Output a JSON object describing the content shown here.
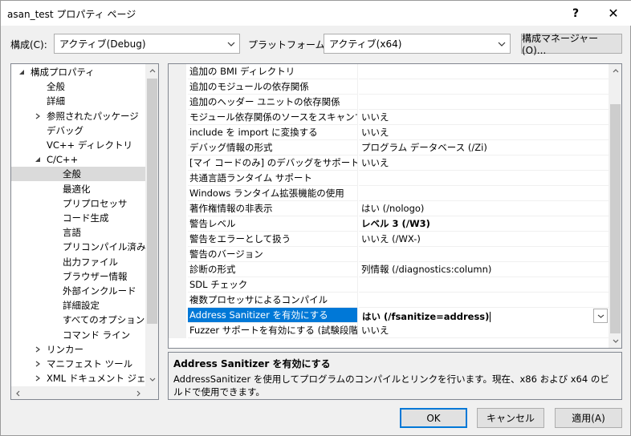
{
  "window": {
    "title": "asan_test プロパティ ページ",
    "help_glyph": "?",
    "close_glyph": "✕"
  },
  "config": {
    "config_label": "構成(C):",
    "config_value": "アクティブ(Debug)",
    "platform_label": "プラットフォーム(P):",
    "platform_value": "アクティブ(x64)",
    "manager_button": "構成マネージャー(O)..."
  },
  "tree": {
    "items": [
      {
        "label": "構成プロパティ",
        "level": 0,
        "expander": "expanded"
      },
      {
        "label": "全般",
        "level": 1,
        "expander": "none"
      },
      {
        "label": "詳細",
        "level": 1,
        "expander": "none"
      },
      {
        "label": "参照されたパッケージ",
        "level": 1,
        "expander": "collapsed"
      },
      {
        "label": "デバッグ",
        "level": 1,
        "expander": "none"
      },
      {
        "label": "VC++ ディレクトリ",
        "level": 1,
        "expander": "none"
      },
      {
        "label": "C/C++",
        "level": 1,
        "expander": "expanded"
      },
      {
        "label": "全般",
        "level": 2,
        "expander": "none",
        "selected": true
      },
      {
        "label": "最適化",
        "level": 2,
        "expander": "none"
      },
      {
        "label": "プリプロセッサ",
        "level": 2,
        "expander": "none"
      },
      {
        "label": "コード生成",
        "level": 2,
        "expander": "none"
      },
      {
        "label": "言語",
        "level": 2,
        "expander": "none"
      },
      {
        "label": "プリコンパイル済みヘッダー",
        "level": 2,
        "expander": "none"
      },
      {
        "label": "出力ファイル",
        "level": 2,
        "expander": "none"
      },
      {
        "label": "ブラウザー情報",
        "level": 2,
        "expander": "none"
      },
      {
        "label": "外部インクルード",
        "level": 2,
        "expander": "none"
      },
      {
        "label": "詳細設定",
        "level": 2,
        "expander": "none"
      },
      {
        "label": "すべてのオプション",
        "level": 2,
        "expander": "none"
      },
      {
        "label": "コマンド ライン",
        "level": 2,
        "expander": "none"
      },
      {
        "label": "リンカー",
        "level": 1,
        "expander": "collapsed"
      },
      {
        "label": "マニフェスト ツール",
        "level": 1,
        "expander": "collapsed"
      },
      {
        "label": "XML ドキュメント ジェネレーター",
        "level": 1,
        "expander": "collapsed"
      }
    ]
  },
  "properties": [
    {
      "name": "追加の BMI ディレクトリ",
      "value": ""
    },
    {
      "name": "追加のモジュールの依存関係",
      "value": ""
    },
    {
      "name": "追加のヘッダー ユニットの依存関係",
      "value": ""
    },
    {
      "name": "モジュール依存関係のソースをスキャンする",
      "value": "いいえ"
    },
    {
      "name": "include を import に変換する",
      "value": "いいえ"
    },
    {
      "name": "デバッグ情報の形式",
      "value": "プログラム データベース (/Zi)"
    },
    {
      "name": "[マイ コードのみ] のデバッグをサポートする",
      "value": "いいえ"
    },
    {
      "name": "共通言語ランタイム サポート",
      "value": ""
    },
    {
      "name": "Windows ランタイム拡張機能の使用",
      "value": ""
    },
    {
      "name": "著作権情報の非表示",
      "value": "はい (/nologo)"
    },
    {
      "name": "警告レベル",
      "value": "レベル 3 (/W3)",
      "bold": true
    },
    {
      "name": "警告をエラーとして扱う",
      "value": "いいえ (/WX-)"
    },
    {
      "name": "警告のバージョン",
      "value": ""
    },
    {
      "name": "診断の形式",
      "value": "列情報 (/diagnostics:column)"
    },
    {
      "name": "SDL チェック",
      "value": ""
    },
    {
      "name": "複数プロセッサによるコンパイル",
      "value": ""
    },
    {
      "name": "Address Sanitizer を有効にする",
      "value": "はい (/fsanitize=address)",
      "selected": true,
      "bold": true
    },
    {
      "name": "Fuzzer サポートを有効にする (試験段階)",
      "value": "いいえ"
    }
  ],
  "description": {
    "title": "Address Sanitizer を有効にする",
    "body": "AddressSanitizer を使用してプログラムのコンパイルとリンクを行います。現在、x86 および x64 のビルドで使用できます。"
  },
  "buttons": {
    "ok": "OK",
    "cancel": "キャンセル",
    "apply": "適用(A)"
  },
  "colors": {
    "selection": "#0078d7",
    "tree_selection": "#dadada",
    "background": "#f0f0f0"
  }
}
